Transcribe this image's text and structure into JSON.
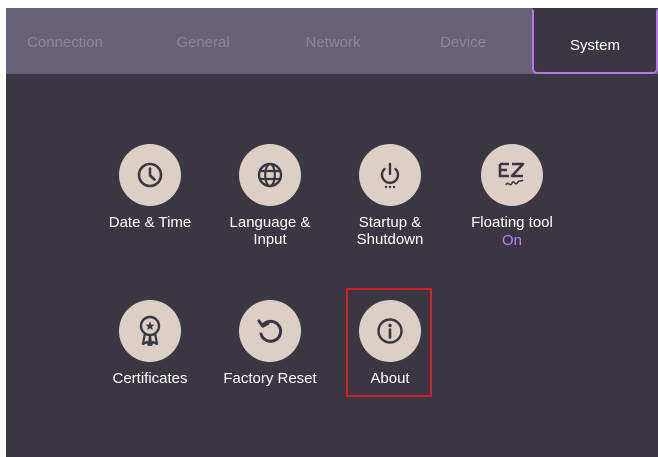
{
  "tabs": [
    {
      "label": "Connection",
      "active": false
    },
    {
      "label": "General",
      "active": false
    },
    {
      "label": "Network",
      "active": false
    },
    {
      "label": "Device",
      "active": false
    },
    {
      "label": "System",
      "active": true
    }
  ],
  "settings": [
    {
      "label": "Date & Time",
      "icon": "clock-icon"
    },
    {
      "label": "Language &\nInput",
      "icon": "globe-icon"
    },
    {
      "label": "Startup &\nShutdown",
      "icon": "power-icon"
    },
    {
      "label": "Floating tool",
      "status": "On",
      "icon": "ez-writer-icon"
    },
    {
      "label": "Certificates",
      "icon": "award-ribbon-icon"
    },
    {
      "label": "Factory Reset",
      "icon": "reset-arrow-icon"
    },
    {
      "label": "About",
      "icon": "info-icon",
      "highlighted": true
    }
  ],
  "colors": {
    "background": "#3b3742",
    "tab_bar": "#696177",
    "accent": "#b678e6",
    "status_on": "#c07ff0",
    "icon_circle": "#dccfc5",
    "highlight_box": "#d51f26"
  }
}
